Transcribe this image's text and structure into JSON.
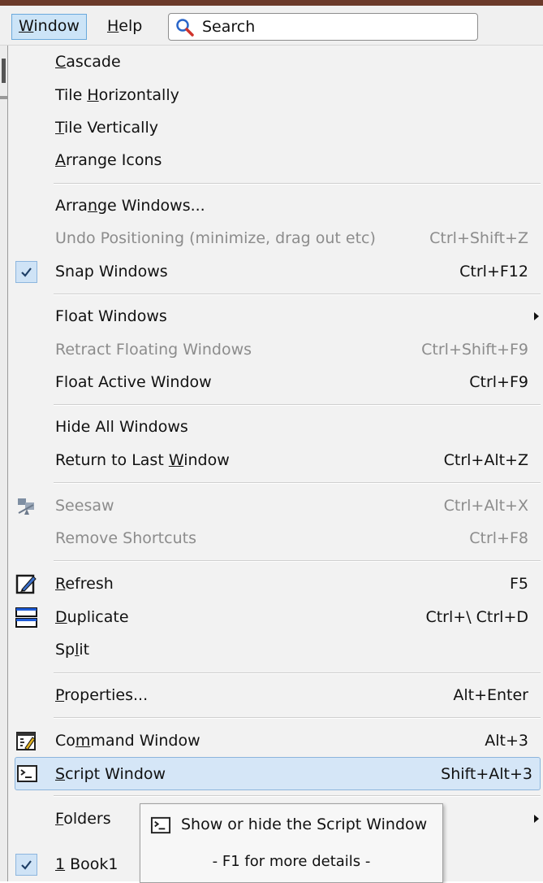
{
  "menubar": {
    "window": "Window",
    "help": "Help",
    "search": "Search"
  },
  "menu": {
    "cascade": "Cascade",
    "tile_h": "Tile Horizontally",
    "tile_v": "Tile Vertically",
    "arrange_icons": "Arrange Icons",
    "arrange_windows": "Arrange Windows...",
    "undo_pos": "Undo Positioning (minimize, drag out etc)",
    "undo_pos_sc": "Ctrl+Shift+Z",
    "snap": "Snap Windows",
    "snap_sc": "Ctrl+F12",
    "float": "Float Windows",
    "retract": "Retract Floating Windows",
    "retract_sc": "Ctrl+Shift+F9",
    "float_active": "Float Active Window",
    "float_active_sc": "Ctrl+F9",
    "hide_all": "Hide All Windows",
    "return_last": "Return to Last Window",
    "return_last_sc": "Ctrl+Alt+Z",
    "seesaw": "Seesaw",
    "seesaw_sc": "Ctrl+Alt+X",
    "remove_sc": "Remove Shortcuts",
    "remove_sc_sc": "Ctrl+F8",
    "refresh": "Refresh",
    "refresh_sc": "F5",
    "duplicate": "Duplicate",
    "duplicate_sc": "Ctrl+\\ Ctrl+D",
    "split": "Split",
    "properties": "Properties...",
    "properties_sc": "Alt+Enter",
    "command": "Command Window",
    "command_sc": "Alt+3",
    "script": "Script Window",
    "script_sc": "Shift+Alt+3",
    "folders": "Folders",
    "book1": "1 Book1"
  },
  "tooltip": {
    "line1": "Show or hide the Script Window",
    "line2": "- F1 for more details -"
  },
  "colors": {
    "highlight": "#d5e6f7",
    "accent": "#6aa9dc"
  }
}
